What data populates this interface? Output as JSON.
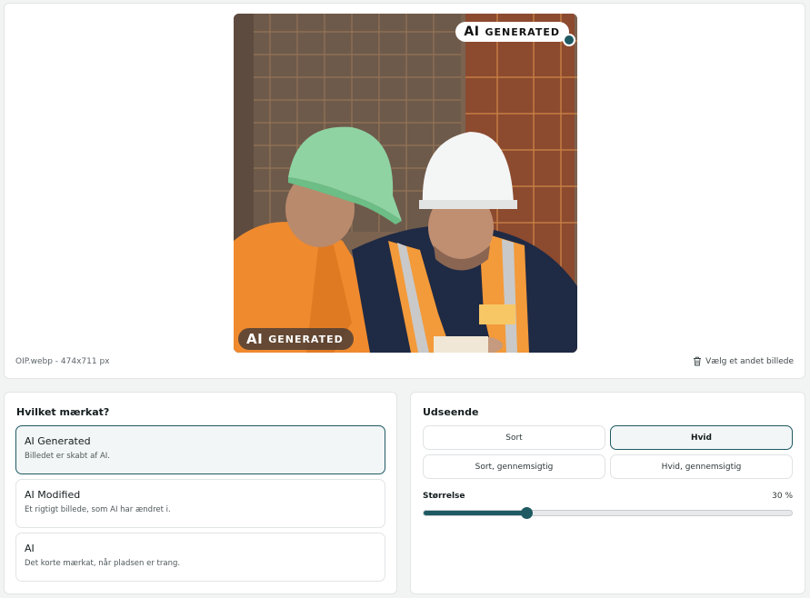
{
  "preview": {
    "badge_top_ai": "AI",
    "badge_top_text": "GENERATED",
    "badge_bottom_ai": "AI",
    "badge_bottom_text": "GENERATED",
    "file_info": "OIP.webp - 474x711 px",
    "change_label": "Vælg et andet billede"
  },
  "label_section": {
    "title": "Hvilket mærkat?",
    "options": [
      {
        "title": "AI Generated",
        "desc": "Billedet er skabt af AI.",
        "selected": true
      },
      {
        "title": "AI Modified",
        "desc": "Et rigtigt billede, som AI har ændret i.",
        "selected": false
      },
      {
        "title": "AI",
        "desc": "Det korte mærkat, når pladsen er trang.",
        "selected": false
      }
    ]
  },
  "appearance": {
    "title": "Udseende",
    "styles": [
      {
        "label": "Sort",
        "selected": false
      },
      {
        "label": "Hvid",
        "selected": true
      },
      {
        "label": "Sort, gennemsigtig",
        "selected": false
      },
      {
        "label": "Hvid, gennemsigtig",
        "selected": false
      }
    ],
    "size_label": "Størrelse",
    "size_value": "30 %",
    "size_fraction": 0.28
  },
  "colors": {
    "accent": "#1f5a63",
    "selected_bg": "#f2f6f6"
  }
}
